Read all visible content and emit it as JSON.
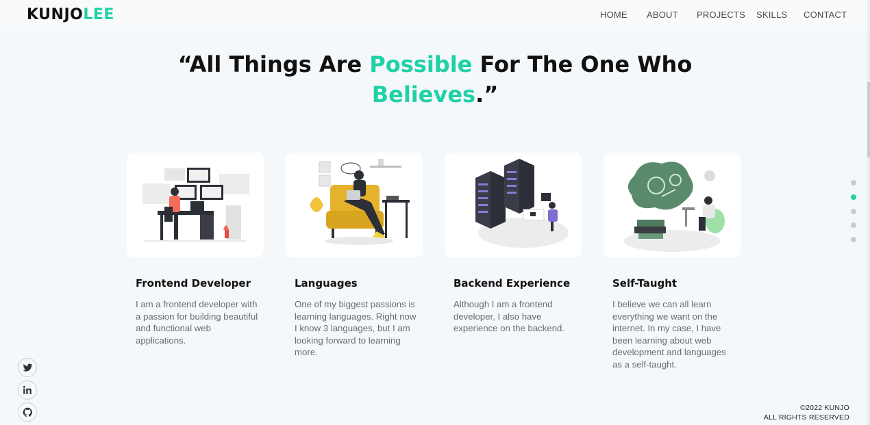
{
  "logo": {
    "part1": "KUNJO",
    "part2": "LEE",
    "accent": "#1fd1a5"
  },
  "nav": {
    "items": [
      "HOME",
      "ABOUT",
      "PROJECTS",
      "SKILLS",
      "CONTACT"
    ]
  },
  "quote": {
    "open": "“All Things Are ",
    "hl1": "Possible",
    "mid": " For The One Who ",
    "hl2": "Believes",
    "close": ".”"
  },
  "cards": [
    {
      "title": "Frontend Developer",
      "text": "I am a frontend developer with a passion for building beautiful and functional web applications.",
      "icon": "developer-at-desk-illustration"
    },
    {
      "title": "Languages",
      "text": "One of my biggest passions is learning languages. Right now I know 3 languages, but I am looking forward to learning more.",
      "icon": "person-on-sofa-laptop-illustration"
    },
    {
      "title": "Backend Experience",
      "text": "Although I am a frontend developer, I also have experience on the backend.",
      "icon": "server-racks-illustration"
    },
    {
      "title": "Self-Taught",
      "text": "I believe we can all learn everything we want on the internet. In my case, I have been learning about web development and languages as a self-taught.",
      "icon": "self-study-illustration"
    }
  ],
  "social": [
    "twitter-icon",
    "linkedin-icon",
    "github-icon"
  ],
  "footer": {
    "line1": "©2022 KUNJO",
    "line2": "ALL RIGHTS RESERVED"
  },
  "colors": {
    "accent": "#1fd1a5",
    "background": "#f5f8fb",
    "card": "#ffffff"
  }
}
